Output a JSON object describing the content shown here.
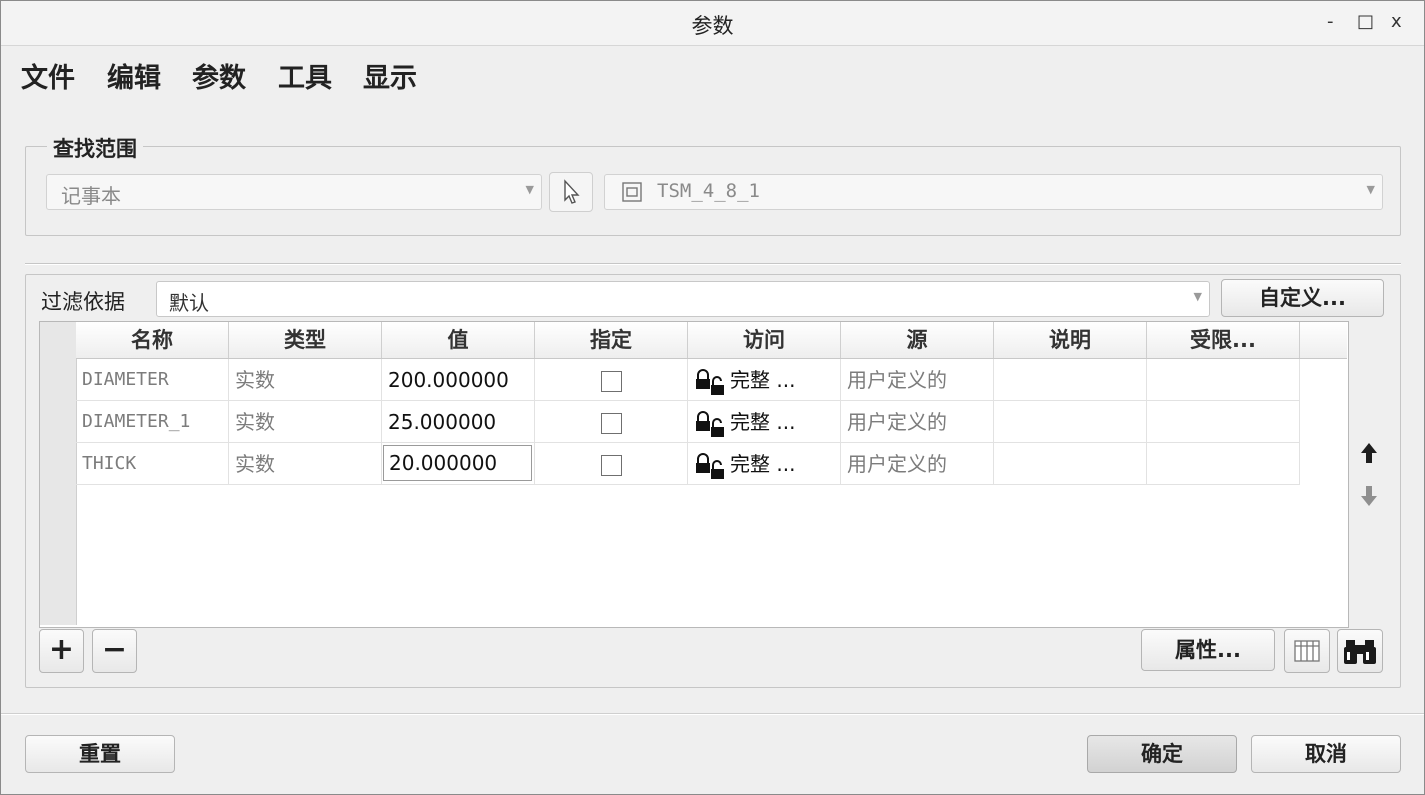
{
  "window": {
    "title": "参数",
    "controls": [
      "-",
      "□",
      "x"
    ]
  },
  "menu": [
    "文件",
    "编辑",
    "参数",
    "工具",
    "显示"
  ],
  "search_scope": {
    "label": "查找范围",
    "type_value": "记事本",
    "model_value": "TSM_4_8_1"
  },
  "filter": {
    "label": "过滤依据",
    "value": "默认",
    "customize_label": "自定义..."
  },
  "table": {
    "columns": [
      "名称",
      "类型",
      "值",
      "指定",
      "访问",
      "源",
      "说明",
      "受限..."
    ],
    "rows": [
      {
        "name": "DIAMETER",
        "type": "实数",
        "value": "200.000000",
        "designated": false,
        "access": "完整 ...",
        "source": "用户定义的",
        "description": "",
        "restricted": ""
      },
      {
        "name": "DIAMETER_1",
        "type": "实数",
        "value": "25.000000",
        "designated": false,
        "access": "完整 ...",
        "source": "用户定义的",
        "description": "",
        "restricted": ""
      },
      {
        "name": "THICK",
        "type": "实数",
        "value": "20.000000",
        "designated": false,
        "access": "完整 ...",
        "source": "用户定义的",
        "description": "",
        "restricted": ""
      }
    ]
  },
  "buttons": {
    "add": "+",
    "remove": "−",
    "properties": "属性...",
    "reset": "重置",
    "ok": "确定",
    "cancel": "取消"
  },
  "icons": {
    "move_up": "arrow-up-icon",
    "move_down": "arrow-down-icon",
    "columns": "columns-icon",
    "find": "binoculars-icon",
    "select": "cursor-select-icon",
    "model": "model-icon",
    "lock": "lock-icon"
  }
}
